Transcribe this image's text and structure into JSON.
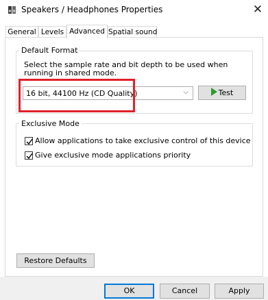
{
  "window": {
    "title": "Speakers / Headphones Properties",
    "close_glyph": "✕"
  },
  "tabs": [
    {
      "label": "General",
      "active": false
    },
    {
      "label": "Levels",
      "active": false
    },
    {
      "label": "Advanced",
      "active": true
    },
    {
      "label": "Spatial sound",
      "active": false
    }
  ],
  "default_format": {
    "group_label": "Default Format",
    "description": "Select the sample rate and bit depth to be used when running in shared mode.",
    "selected_format": "16 bit, 44100 Hz (CD Quality)",
    "test_label": "Test"
  },
  "exclusive_mode": {
    "group_label": "Exclusive Mode",
    "options": [
      {
        "label": "Allow applications to take exclusive control of this device",
        "checked": true
      },
      {
        "label": "Give exclusive mode applications priority",
        "checked": true
      }
    ]
  },
  "restore_defaults_label": "Restore Defaults",
  "footer": {
    "ok_label": "OK",
    "cancel_label": "Cancel",
    "apply_label": "Apply"
  },
  "colors": {
    "highlight": "#e0202a",
    "focus_border": "#0078d7",
    "play_icon": "#2e9b2e"
  }
}
